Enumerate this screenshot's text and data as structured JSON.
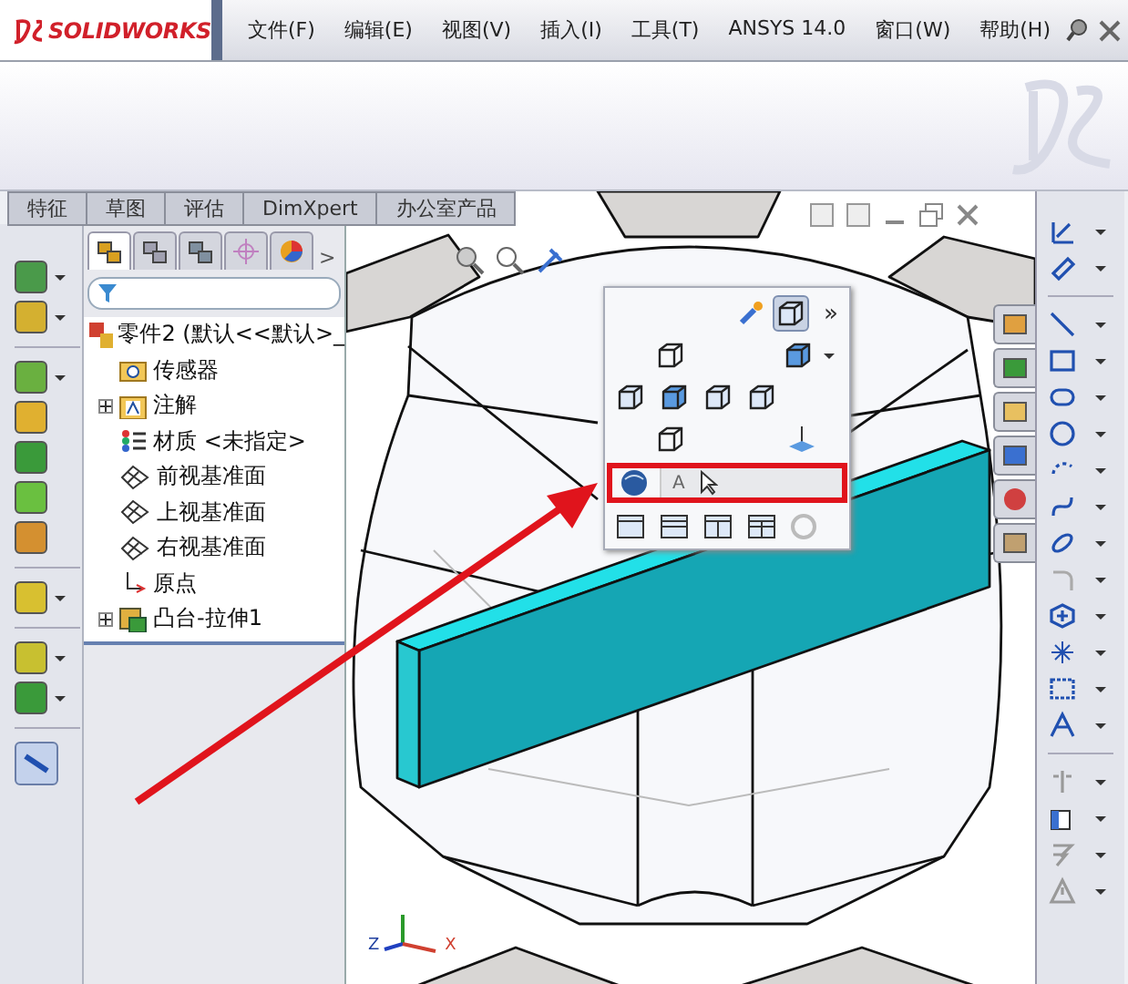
{
  "app": {
    "logo_text": "SOLIDWORKS"
  },
  "menu": [
    "文件(F)",
    "编辑(E)",
    "视图(V)",
    "插入(I)",
    "工具(T)",
    "ANSYS 14.0",
    "窗口(W)",
    "帮助(H)"
  ],
  "command_tabs": [
    {
      "label": "特征"
    },
    {
      "label": "草图"
    },
    {
      "label": "评估"
    },
    {
      "label": "DimXpert"
    },
    {
      "label": "办公室产品"
    }
  ],
  "panel_tabs": [
    {
      "kind": "tree",
      "selected": true
    },
    {
      "kind": "property",
      "selected": false
    },
    {
      "kind": "config",
      "selected": false
    },
    {
      "kind": "target",
      "selected": false
    },
    {
      "kind": "appearance",
      "selected": false
    }
  ],
  "panel_tabs_more": ">",
  "tree": {
    "root": "零件2  (默认<<默认>_",
    "children": [
      {
        "label": "传感器",
        "kind": "sensor",
        "expandable": false
      },
      {
        "label": "注解",
        "kind": "annotation",
        "expandable": true
      },
      {
        "label": "材质 <未指定>",
        "kind": "material",
        "expandable": false
      },
      {
        "label": "前视基准面",
        "kind": "plane",
        "expandable": false
      },
      {
        "label": "上视基准面",
        "kind": "plane",
        "expandable": false
      },
      {
        "label": "右视基准面",
        "kind": "plane",
        "expandable": false
      },
      {
        "label": "原点",
        "kind": "origin",
        "expandable": false
      },
      {
        "label": "凸台-拉伸1",
        "kind": "feature",
        "expandable": true
      }
    ]
  },
  "view_menu": {
    "more": "»",
    "search_value": "A"
  },
  "triad": {
    "z": "Z",
    "x": "X"
  }
}
